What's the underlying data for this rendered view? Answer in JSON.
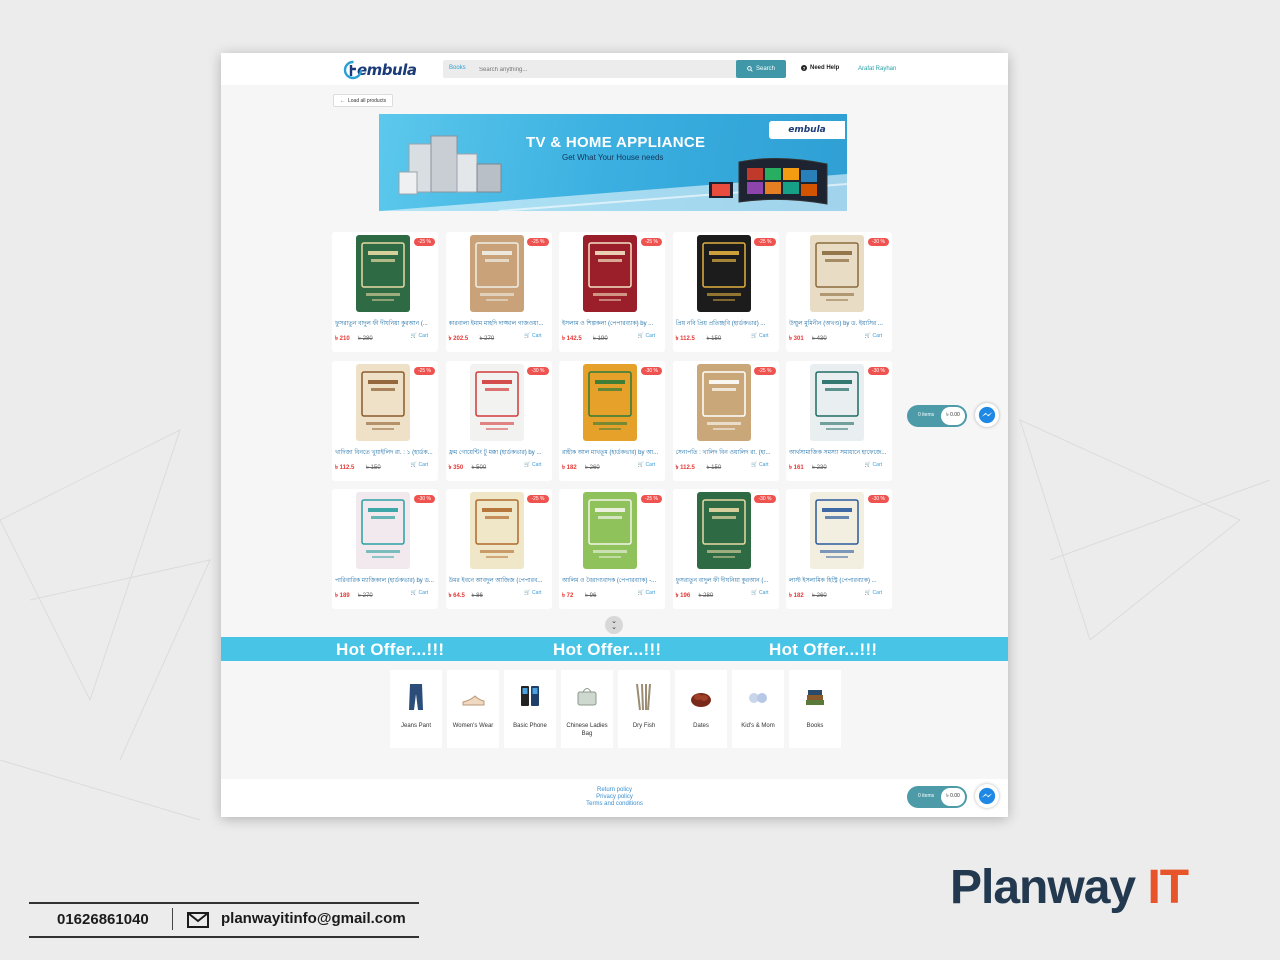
{
  "header": {
    "logo_text": "embula",
    "search_category": "Books",
    "search_placeholder": "Search anything...",
    "search_button": "Search",
    "help_label": "Need Help",
    "user_name": "Arafat Rayhan"
  },
  "load_all": "Load all products",
  "banner": {
    "title": "TV & HOME APPLIANCE",
    "subtitle": "Get What Your House needs",
    "logo": "embula"
  },
  "products": [
    {
      "title": "ফুসরাতুন বাদুল ফী দীঘনিয়া কুরআন (...",
      "price": "৳ 210",
      "old": "৳ 280",
      "discount": "-25 %",
      "color": "#2e6b44",
      "accent": "#e9d9a5"
    },
    {
      "title": "কারবালা ইমাম মাহদি দাজ্জাল গাজওয়া...",
      "price": "৳ 202.5",
      "old": "৳ 270",
      "discount": "-25 %",
      "color": "#c9a27a",
      "accent": "#f0efe8"
    },
    {
      "title": "ইসলাম ও শিল্পকলা (পেপারব্যাক) by ...",
      "price": "৳ 142.5",
      "old": "৳ 190",
      "discount": "-25 %",
      "color": "#9b1f2a",
      "accent": "#f3e2c3"
    },
    {
      "title": "প্রিয় নবি প্রিয় প্রতিচ্ছবি (হার্ডকভার) ...",
      "price": "৳ 112.5",
      "old": "৳ 150",
      "discount": "-25 %",
      "color": "#1c1c1c",
      "accent": "#e0b040"
    },
    {
      "title": "উম্মুল মুমিনীন (অখণ্ড) by ড. ইয়াসির ...",
      "price": "৳ 301",
      "old": "৳ 430",
      "discount": "-30 %",
      "color": "#e8dcc4",
      "accent": "#8a6a3c"
    },
    {
      "title": "খাদিজা বিনতে খুয়াইলিদ রা. : ১ (হার্ডক...",
      "price": "৳ 112.5",
      "old": "৳ 150",
      "discount": "-25 %",
      "color": "#efe1c8",
      "accent": "#8a5b2c"
    },
    {
      "title": "ফ্রম গোয়েন্টিং টু মক্কা (হার্ডকভার) by ...",
      "price": "৳ 350",
      "old": "৳ 500",
      "discount": "-30 %",
      "color": "#f2f2f0",
      "accent": "#d23a3a"
    },
    {
      "title": "রাহীক আল মাখতূম (হার্ডকভার) by আ...",
      "price": "৳ 182",
      "old": "৳ 260",
      "discount": "-30 %",
      "color": "#e6a12a",
      "accent": "#2d7a3a"
    },
    {
      "title": "সেনাপতি : খালিদ বিন ওয়ালিদ রা. (হা...",
      "price": "৳ 112.5",
      "old": "৳ 150",
      "discount": "-25 %",
      "color": "#c9a778",
      "accent": "#ffffff"
    },
    {
      "title": "আর্থসামাজিক সমস্যা সমাধানে হাফেজে...",
      "price": "৳ 161",
      "old": "৳ 230",
      "discount": "-30 %",
      "color": "#e9eef0",
      "accent": "#1f6b64"
    },
    {
      "title": "পারিবারিক ম্যাজিকাল (হার্ডকভার) by ড...",
      "price": "৳ 189",
      "old": "৳ 270",
      "discount": "-30 %",
      "color": "#f1e9ee",
      "accent": "#2aa0a0"
    },
    {
      "title": "উমর ইবনে আবদুল আজিজ (পেপারব...",
      "price": "৳ 64.5",
      "old": "৳ 86",
      "discount": "-25 %",
      "color": "#f0e6c8",
      "accent": "#b06a2c"
    },
    {
      "title": "আলিম ও বৈরাগ্যবাদক (পেপারব্যাক) -...",
      "price": "৳ 72",
      "old": "৳ 96",
      "discount": "-25 %",
      "color": "#8fc25a",
      "accent": "#f4f4ec"
    },
    {
      "title": "ফুসরাতুন বাদুল ফী দীঘনিয়া কুরআন (...",
      "price": "৳ 196",
      "old": "৳ 280",
      "discount": "-30 %",
      "color": "#2e6b44",
      "accent": "#e9d9a5"
    },
    {
      "title": "লাস্ট ইসলামিক হিস্ট্রি (পেপারব্যাক) ...",
      "price": "৳ 182",
      "old": "৳ 260",
      "discount": "-30 %",
      "color": "#f2efe0",
      "accent": "#2b5a9e"
    }
  ],
  "cart_label": "Cart",
  "hot_offer": "Hot Offer...!!!",
  "categories": [
    {
      "label": "Jeans Pant",
      "icon": "jeans-icon"
    },
    {
      "label": "Women's Wear",
      "icon": "shoe-icon"
    },
    {
      "label": "Basic Phone",
      "icon": "phone-icon"
    },
    {
      "label": "Chinese Ladies Bag",
      "icon": "bag-icon"
    },
    {
      "label": "Dry Fish",
      "icon": "fish-icon"
    },
    {
      "label": "Dates",
      "icon": "dates-icon"
    },
    {
      "label": "Kid's & Mom",
      "icon": "baby-icon"
    },
    {
      "label": "Books",
      "icon": "books-icon"
    }
  ],
  "footer_links": [
    "Return policy",
    "Privacy policy",
    "Terms and conditions"
  ],
  "mini_cart": {
    "items": "0 items",
    "total": "৳ 0.00"
  },
  "contact": {
    "phone": "01626861040",
    "email": "planwayitinfo@gmail.com"
  },
  "brand": {
    "name": "Planway",
    "suffix": "IT",
    "colors": {
      "name": "#22394f",
      "suffix": "#e8542a"
    }
  },
  "colors": {
    "accent": "#47c4e6",
    "search_button": "#3f97a8",
    "discount": "#ef5350"
  }
}
